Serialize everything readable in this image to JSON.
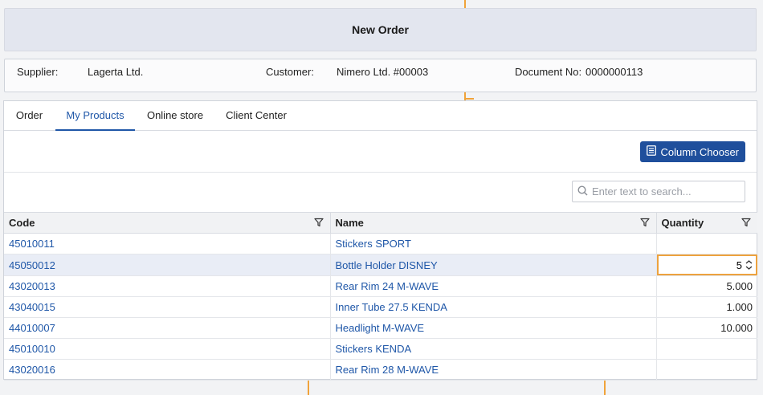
{
  "header": {
    "title": "New Order"
  },
  "info": {
    "supplier_label": "Supplier:",
    "supplier_value": "Lagerta Ltd.",
    "customer_label": "Customer:",
    "customer_value": "Nimero Ltd. #00003",
    "document_label": "Document No:",
    "document_value": "0000000113"
  },
  "tabs": [
    {
      "label": "Order"
    },
    {
      "label": "My Products",
      "active": true
    },
    {
      "label": "Online store"
    },
    {
      "label": "Client Center"
    }
  ],
  "toolbar": {
    "column_chooser_label": "Column Chooser"
  },
  "search": {
    "placeholder": "Enter text to search..."
  },
  "table": {
    "columns": [
      {
        "label": "Code"
      },
      {
        "label": "Name"
      },
      {
        "label": "Quantity"
      }
    ],
    "rows": [
      {
        "code": "45010011",
        "name": "Stickers SPORT",
        "quantity": ""
      },
      {
        "code": "45050012",
        "name": "Bottle Holder DISNEY",
        "quantity": "5",
        "editing": true
      },
      {
        "code": "43020013",
        "name": "Rear Rim 24 M-WAVE",
        "quantity": "5.000"
      },
      {
        "code": "43040015",
        "name": "Inner Tube 27.5 KENDA",
        "quantity": "1.000"
      },
      {
        "code": "44010007",
        "name": "Headlight M-WAVE",
        "quantity": "10.000"
      },
      {
        "code": "45010010",
        "name": "Stickers KENDA",
        "quantity": ""
      },
      {
        "code": "43020016",
        "name": "Rear Rim 28 M-WAVE",
        "quantity": ""
      }
    ]
  },
  "colors": {
    "accent": "#1f57a8",
    "button": "#1f4f9c",
    "edit_highlight": "#eda23e",
    "selected_row": "#e9edf6"
  },
  "icons": {
    "column_chooser": "list-icon",
    "search": "search-icon",
    "filter": "filter-icon",
    "spinner": "spinner-arrows-icon"
  }
}
